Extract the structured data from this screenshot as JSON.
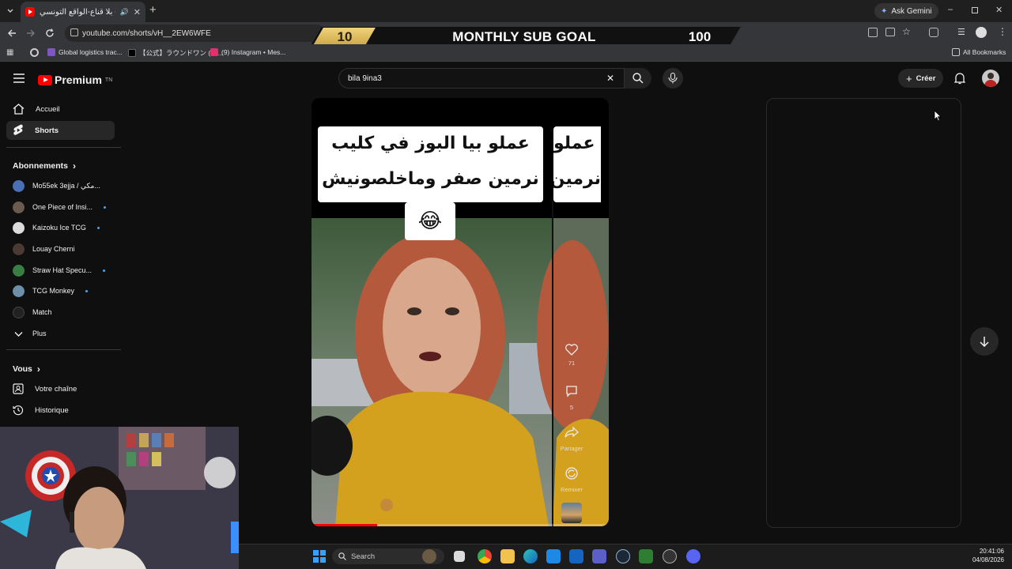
{
  "browser": {
    "tab_title": "بلا قناع-الواقع التونسي - YouTube",
    "new_tab": "+",
    "ask_gemini": "Ask Gemini",
    "url": "youtube.com/shorts/vH__2EW6WFE",
    "bookmarks": [
      {
        "label": "Global logistics trac...",
        "color": "#7e57c2"
      },
      {
        "label": "【公式】ラウンドワン (@...",
        "color": "#000000"
      },
      {
        "label": "(9) Instagram • Mes...",
        "color": "#e1306c"
      }
    ],
    "all_bookmarks": "All Bookmarks"
  },
  "overlay": {
    "goal_start": "10",
    "goal_label": "MONTHLY SUB GOAL",
    "goal_end": "100"
  },
  "youtube": {
    "logo_text": "Premium",
    "logo_region": "TN",
    "search_value": "bila 9ina3",
    "create_label": "Créer"
  },
  "sidebar": {
    "main": [
      {
        "label": "Accueil",
        "icon": "home-icon"
      },
      {
        "label": "Shorts",
        "icon": "shorts-icon",
        "active": true
      }
    ],
    "subscriptions_title": "Abonnements",
    "subscriptions": [
      {
        "label": "Mo55ek 3ejja / مكي...",
        "color": "#4a6fb5",
        "dot": false
      },
      {
        "label": "One Piece of Insi...",
        "color": "#6b5a4e",
        "dot": true
      },
      {
        "label": "Kaizoku Ice TCG",
        "color": "#dcdcdc",
        "dot": true
      },
      {
        "label": "Louay Cherni",
        "color": "#4b3a33",
        "dot": false
      },
      {
        "label": "Straw Hat Specu...",
        "color": "#3a7d44",
        "dot": true
      },
      {
        "label": "TCG Monkey",
        "color": "#6d8fa8",
        "dot": true
      },
      {
        "label": "Match",
        "color": "#222222",
        "dot": false
      },
      {
        "label": "Plus",
        "color": "",
        "dot": false
      }
    ],
    "you_title": "Vous",
    "you_items": [
      {
        "label": "Votre chaîne",
        "icon": "channel-icon"
      },
      {
        "label": "Historique",
        "icon": "history-icon"
      }
    ]
  },
  "short": {
    "caption_line1": "عملو بيا البوز في كليب",
    "caption_line2": "نرمين صفر وماخلصونيش",
    "caption_emoji": "😂",
    "side_caption_line1": "عملو",
    "side_caption_line2": "نرمين",
    "likes": "71",
    "comments": "5",
    "share_label": "Partager",
    "remix_label": "Remixer",
    "progress": 0.22
  },
  "taskbar": {
    "search_label": "Search",
    "time": "20:41:06",
    "date": "04/08/2026"
  }
}
